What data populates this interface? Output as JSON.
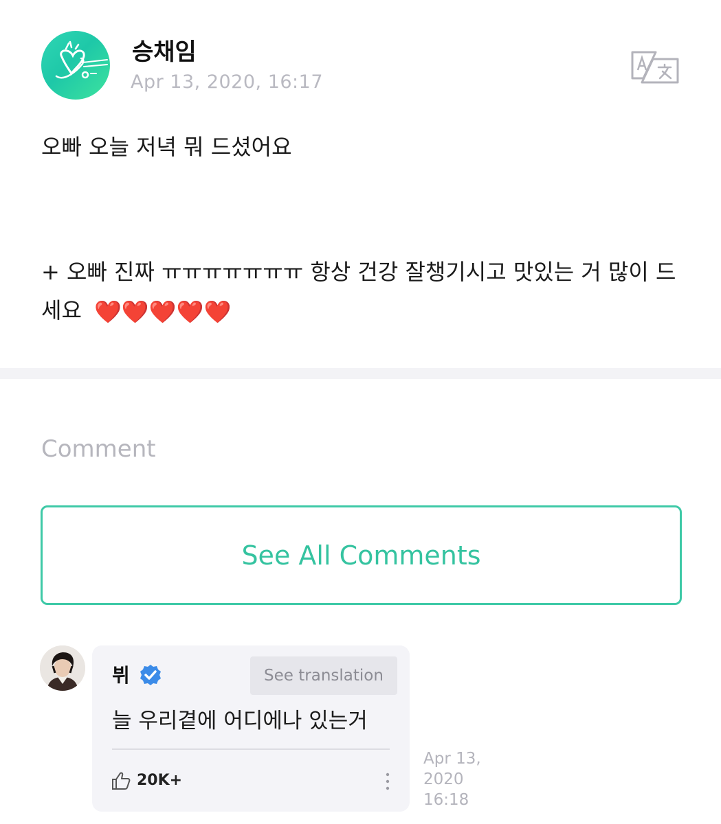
{
  "post": {
    "author": "승채임",
    "date": "Apr 13, 2020, 16:17",
    "body_line1": "오빠 오늘 저녁 뭐 드셨어요",
    "body_line2": "+ 오빠 진짜 ㅠㅠㅠㅠㅠㅠㅠ 항상 건강 잘챙기시고 맛있는 거 많이 드세요",
    "hearts": "❤️❤️❤️❤️❤️",
    "avatar_icon": "heart-scribble-avatar",
    "translate_icon": "translate-icon"
  },
  "comments_section": {
    "heading": "Comment",
    "see_all_label": "See All Comments",
    "accent_color": "#3ec9a7"
  },
  "comment": {
    "author": "뷔",
    "verified_icon": "verified-badge-icon",
    "see_translation_label": "See translation",
    "text": "늘 우리곁에 어디에나 있는거",
    "likes": "20K+",
    "date_line1": "Apr 13,",
    "date_line2": "2020",
    "date_line3": "16:18"
  }
}
